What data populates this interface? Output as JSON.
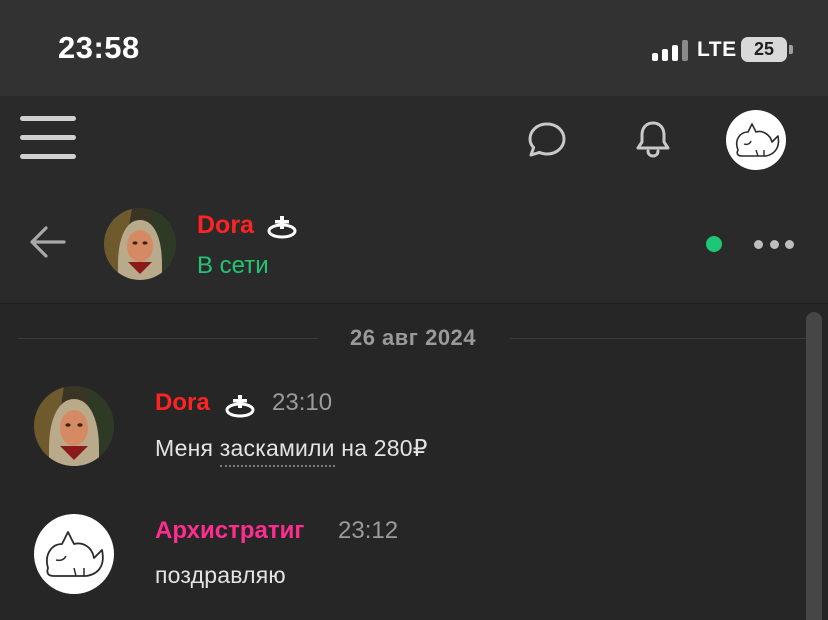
{
  "status_bar": {
    "time": "23:58",
    "network": "LTE",
    "battery": "25"
  },
  "app_header": {
    "icons": [
      "menu-icon",
      "chat-bubble-icon",
      "bell-icon",
      "user-avatar"
    ]
  },
  "chat_header": {
    "contact_name": "Dora",
    "contact_status": "В сети",
    "name_color": "#ff2323",
    "status_color": "#22c574",
    "online": true
  },
  "messages": {
    "date_separator": "26 авг 2024",
    "items": [
      {
        "author": "Dora",
        "author_color": "#ff2323",
        "time": "23:10",
        "text_before": "Меня ",
        "text_link": "заскамили",
        "text_after": " на 280₽"
      },
      {
        "author": "Архистратиг",
        "author_color": "#ff2d8f",
        "time": "23:12",
        "text": "поздравляю"
      }
    ]
  }
}
